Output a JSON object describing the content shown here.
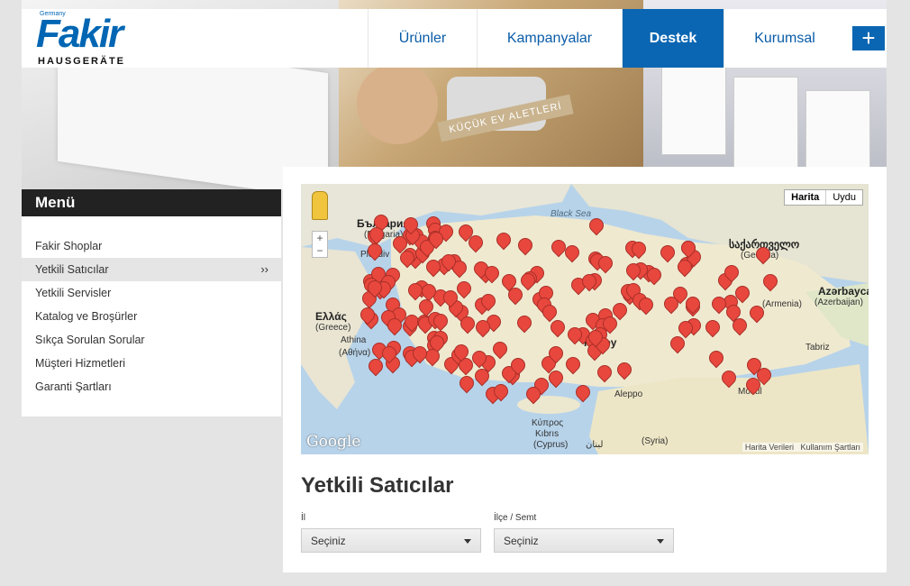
{
  "brand": {
    "country": "Germany",
    "name": "Fakir",
    "sub": "HAUSGERÄTE"
  },
  "hero": {
    "banner_text": "KÜÇÜK EV ALETLERİ"
  },
  "nav": {
    "items": [
      {
        "label": "Ürünler",
        "active": false
      },
      {
        "label": "Kampanyalar",
        "active": false
      },
      {
        "label": "Destek",
        "active": true
      },
      {
        "label": "Kurumsal",
        "active": false
      }
    ],
    "plus_label": "+"
  },
  "sidebar": {
    "title": "Menü",
    "items": [
      {
        "label": "Fakir Shoplar"
      },
      {
        "label": "Yetkili Satıcılar",
        "active": true,
        "chevron": "››"
      },
      {
        "label": "Yetkili Servisler"
      },
      {
        "label": "Katalog ve Broşürler"
      },
      {
        "label": "Sıkça Sorulan Sorular"
      },
      {
        "label": "Müşteri Hizmetleri"
      },
      {
        "label": "Garanti Şartları"
      }
    ]
  },
  "map": {
    "type_map": "Harita",
    "type_sat": "Uydu",
    "zoom_in": "+",
    "zoom_out": "−",
    "google": "Google",
    "footer_data": "Harita Verileri",
    "footer_terms": "Kullanım Şartları",
    "labels": {
      "bulgaria": "България",
      "bulgaria_sub": "(Bulgaria)",
      "plovdiv": "Plovdiv",
      "black_sea": "Black Sea",
      "greece": "Ελλάς",
      "greece_sub": "(Greece)",
      "athina": "Athina",
      "athina_sub": "(Αθήνα)",
      "turkey": "Turkey",
      "georgia": "საქართველო",
      "georgia_sub": "(Georgia)",
      "armenia": "(Armenia)",
      "azerbaijan": "Azərbaycan",
      "azerbaijan_sub": "(Azerbaijan)",
      "tabriz": "Tabriz",
      "mosul": "Mosul",
      "aleppo": "Aleppo",
      "cyprus": "Κύπρος",
      "cyprus_tr": "Kıbrıs",
      "cyprus_sub": "(Cyprus)",
      "syria": "(Syria)",
      "lebanon": "لبنان"
    }
  },
  "page": {
    "title": "Yetkili Satıcılar",
    "il_label": "İl",
    "il_value": "Seçiniz",
    "ilce_label": "İlçe / Semt",
    "ilce_value": "Seçiniz"
  },
  "colors": {
    "accent": "#0a66b2",
    "marker": "#e8473d",
    "sea": "#b7d3ea"
  }
}
